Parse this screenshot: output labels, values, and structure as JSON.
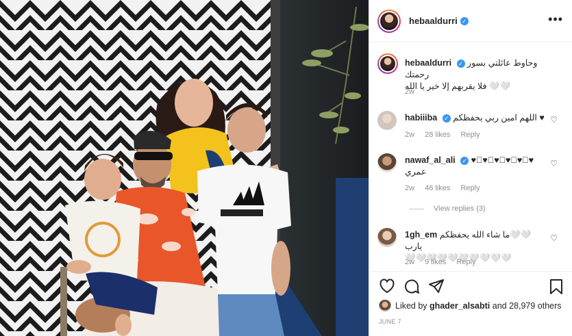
{
  "post": {
    "username": "hebaaldurri",
    "verified_mark": "✓",
    "more_icon": "•••",
    "caption_line1": "وحاوط عائلتي بسور رحمتك",
    "caption_line2": "🤍🤍 فلا يقربهم إلا خير يا الله",
    "caption_time": "2w",
    "liked_by_prefix": "Liked by",
    "liked_by_user": "ghader_alsabti",
    "liked_by_suffix": "and 28,979 others",
    "date": "JUNE 7"
  },
  "comments": [
    {
      "username": "habiiiba",
      "verified": true,
      "text": "♥ اللهم امين ربي يحفظكم",
      "time": "2w",
      "likes": "28 likes",
      "reply": "Reply"
    },
    {
      "username": "nawaf_al_ali",
      "verified": true,
      "text": "♥🏻♥🏻♥🏻♥🏻♥🏻♥",
      "text2": "عمري",
      "time": "2w",
      "likes": "46 likes",
      "reply": "Reply",
      "view_replies": "View replies (3)"
    },
    {
      "username": "1gh_em",
      "verified": false,
      "text": "🤍🤍ما شاء الله يحفظكم يارب",
      "text2": "🤍🤍🤍🤍🤍🤍🤍🤍🤍🤍",
      "time": "2w",
      "likes": "9 likes",
      "reply": "Reply"
    }
  ],
  "icons": {
    "like": "heart-icon",
    "comment": "comment-icon",
    "share": "share-icon",
    "save": "bookmark-icon",
    "comment_like": "heart-icon"
  },
  "colors": {
    "verified": "#3897f0",
    "muted": "#8e8e8e",
    "text": "#262626",
    "border": "#efefef"
  }
}
